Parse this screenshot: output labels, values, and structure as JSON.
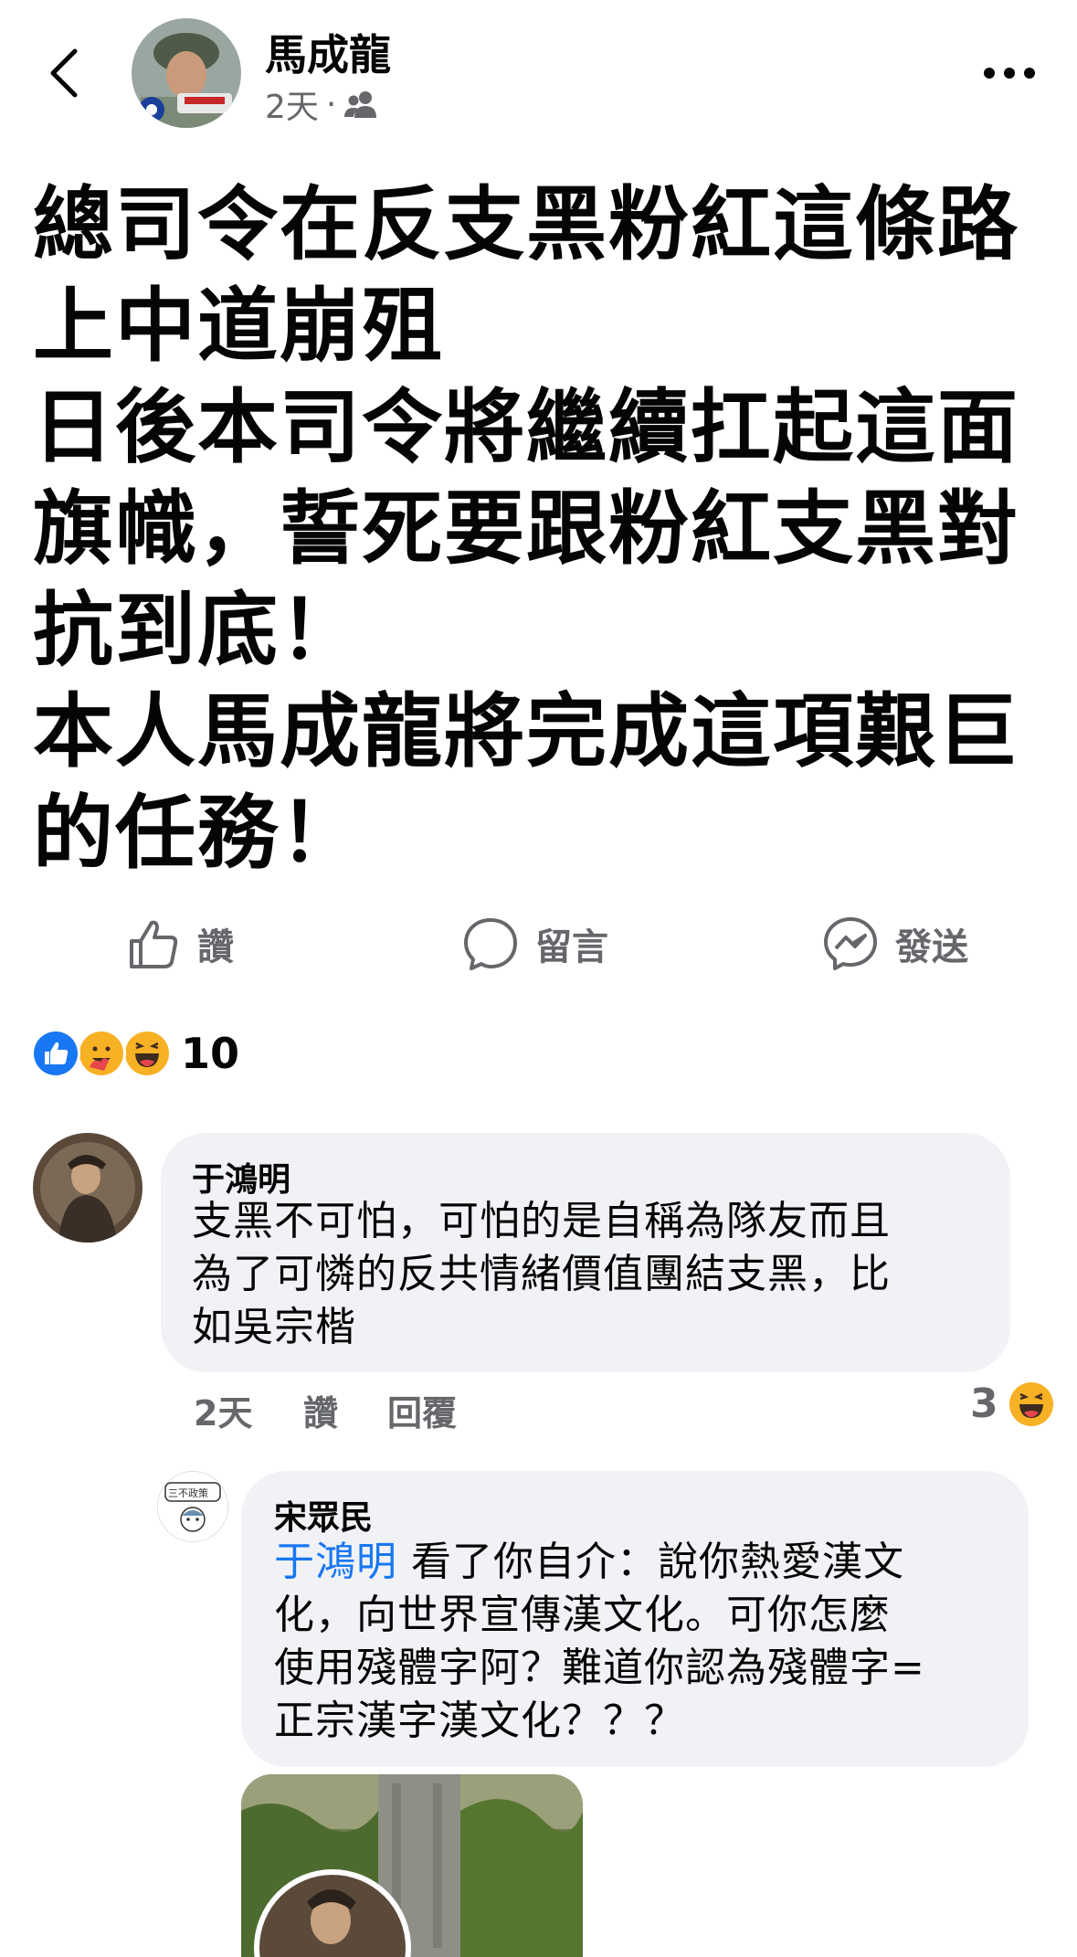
{
  "header": {
    "author": "馬成龍",
    "time": "2天",
    "separator": "·",
    "audience_icon": "friends-icon"
  },
  "post": {
    "lines": [
      "總司令在反支黑粉紅這條路",
      "上中道崩殂",
      "日後本司令將繼續扛起這面",
      "旗幟，誓死要跟粉紅支黑對",
      "抗到底！",
      "本人馬成龍將完成這項艱巨",
      "的任務！"
    ]
  },
  "actions": {
    "like": "讚",
    "comment": "留言",
    "send": "發送"
  },
  "reactions": {
    "icons": [
      "like-icon",
      "care-icon",
      "haha-icon"
    ],
    "count": "10"
  },
  "comments": [
    {
      "name": "于鴻明",
      "lines": [
        "支黑不可怕，可怕的是自稱為隊友而且",
        "為了可憐的反共情緒價值團結支黑，比",
        "如吳宗楷"
      ],
      "time": "2天",
      "like": "讚",
      "reply": "回覆",
      "reaction_count": "3"
    },
    {
      "name": "宋眾民",
      "avatar_label": "三不政策",
      "mention": "于鴻明",
      "first_line_rest": " 看了你自介：說你熱愛漢文",
      "lines": [
        "化，向世界宣傳漢文化。可你怎麼",
        "使用殘體字阿？難道你認為殘體字=",
        "正宗漢字漢文化？？？"
      ]
    }
  ]
}
